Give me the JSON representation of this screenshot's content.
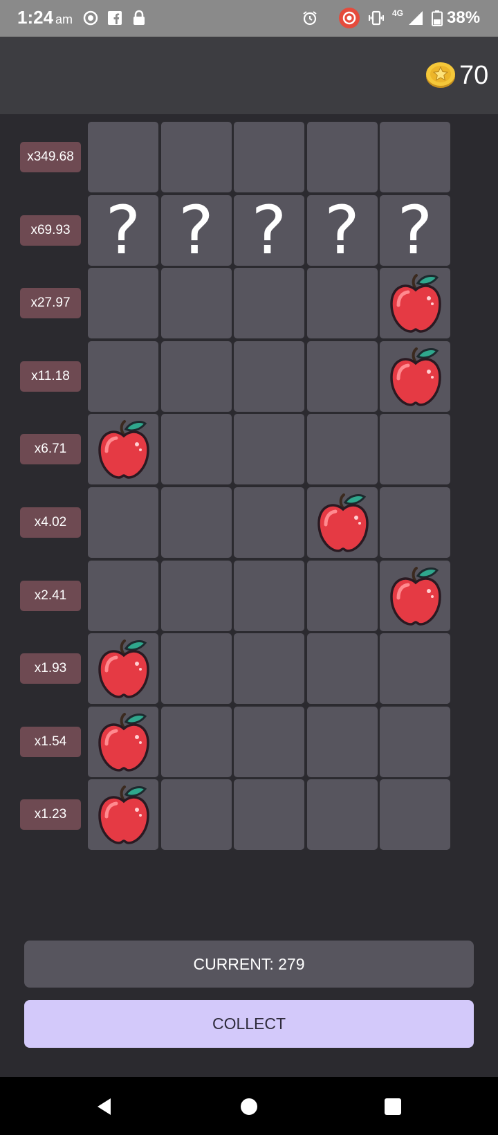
{
  "status_bar": {
    "time": "1:24",
    "ampm": "am",
    "network": "4G",
    "battery": "38%",
    "icons": [
      "notification-icon",
      "facebook-icon",
      "lock-icon",
      "alarm-icon",
      "recording-icon",
      "vibrate-icon",
      "signal-icon",
      "battery-icon"
    ]
  },
  "header": {
    "coin_icon": "coin-star-icon",
    "coins": "70"
  },
  "board": {
    "multipliers": [
      "x349.68",
      "x69.93",
      "x27.97",
      "x11.18",
      "x6.71",
      "x4.02",
      "x2.41",
      "x1.93",
      "x1.54",
      "x1.23"
    ],
    "rows": [
      [
        "empty",
        "empty",
        "empty",
        "empty",
        "empty"
      ],
      [
        "?",
        "?",
        "?",
        "?",
        "?"
      ],
      [
        "empty",
        "empty",
        "empty",
        "empty",
        "apple"
      ],
      [
        "empty",
        "empty",
        "empty",
        "empty",
        "apple"
      ],
      [
        "apple",
        "empty",
        "empty",
        "empty",
        "empty"
      ],
      [
        "empty",
        "empty",
        "empty",
        "apple",
        "empty"
      ],
      [
        "empty",
        "empty",
        "empty",
        "empty",
        "apple"
      ],
      [
        "apple",
        "empty",
        "empty",
        "empty",
        "empty"
      ],
      [
        "apple",
        "empty",
        "empty",
        "empty",
        "empty"
      ],
      [
        "apple",
        "empty",
        "empty",
        "empty",
        "empty"
      ]
    ]
  },
  "current": {
    "label": "CURRENT: 279"
  },
  "collect": {
    "label": "COLLECT"
  },
  "nav": {
    "icons": [
      "back-icon",
      "home-icon",
      "recents-icon"
    ]
  },
  "colors": {
    "background": "#2b2a2f",
    "cell": "#57555e",
    "label_badge": "#6e4a52",
    "collect_button": "#d3c9fa",
    "apple": "#e53a44"
  }
}
